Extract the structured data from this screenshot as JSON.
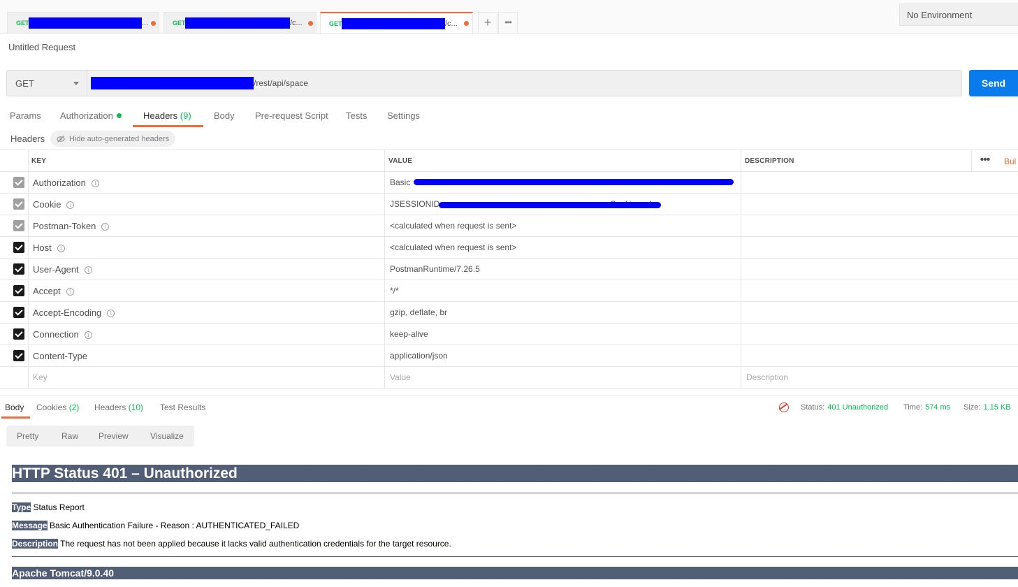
{
  "tabs": [
    {
      "method": "GET",
      "name": "...",
      "redact_width": 162
    },
    {
      "method": "GET",
      "name": "/c...",
      "redact_width": 150
    },
    {
      "method": "GET",
      "name": "/c...",
      "redact_width": 148,
      "active": true
    }
  ],
  "tab_actions": {
    "add": "+",
    "more": "•••"
  },
  "environment": "No Environment",
  "request_title": "Untitled Request",
  "url_bar": {
    "method": "GET",
    "url_suffix": "/rest/api/space",
    "send_label": "Send"
  },
  "request_tabs": [
    {
      "label": "Params"
    },
    {
      "label": "Authorization",
      "dot": true
    },
    {
      "label": "Headers",
      "count": "(9)",
      "active": true
    },
    {
      "label": "Body"
    },
    {
      "label": "Pre-request Script"
    },
    {
      "label": "Tests"
    },
    {
      "label": "Settings"
    }
  ],
  "headers_section": {
    "label": "Headers",
    "hide_auto": "Hide auto-generated headers"
  },
  "table": {
    "columns": [
      "KEY",
      "VALUE",
      "DESCRIPTION"
    ],
    "more": "•••",
    "bulk": "Bul",
    "rows": [
      {
        "key": "Authorization",
        "value": "Basic",
        "checked": true,
        "auto": true
      },
      {
        "key": "Cookie",
        "value": "JSESSIONID=",
        "value_tail": "; Cookie=value",
        "checked": true,
        "auto": true
      },
      {
        "key": "Postman-Token",
        "value": "<calculated when request is sent>",
        "checked": true,
        "auto": true
      },
      {
        "key": "Host",
        "value": "<calculated when request is sent>",
        "checked": true
      },
      {
        "key": "User-Agent",
        "value": "PostmanRuntime/7.26.5",
        "checked": true
      },
      {
        "key": "Accept",
        "value": "*/*",
        "checked": true
      },
      {
        "key": "Accept-Encoding",
        "value": "gzip, deflate, br",
        "checked": true
      },
      {
        "key": "Connection",
        "value": "keep-alive",
        "checked": true
      },
      {
        "key": "Content-Type",
        "value": "application/json",
        "checked": true,
        "no_info": true
      }
    ],
    "placeholders": {
      "key": "Key",
      "value": "Value",
      "description": "Description"
    }
  },
  "response": {
    "tabs": [
      {
        "label": "Body",
        "active": true
      },
      {
        "label": "Cookies",
        "count": "(2)"
      },
      {
        "label": "Headers",
        "count": "(10)"
      },
      {
        "label": "Test Results"
      }
    ],
    "status_label": "Status:",
    "status_value": "401 Unauthorized",
    "time_label": "Time:",
    "time_value": "574 ms",
    "size_label": "Size:",
    "size_value": "1.15 KB",
    "view_modes": [
      "Pretty",
      "Raw",
      "Preview",
      "Visualize"
    ]
  },
  "error_page": {
    "title": "HTTP Status 401 – Unauthorized",
    "type_label": "Type",
    "type_value": "Status Report",
    "message_label": "Message",
    "message_value": "Basic Authentication Failure - Reason : AUTHENTICATED_FAILED",
    "description_label": "Description",
    "description_value": "The request has not been applied because it lacks valid authentication credentials for the target resource.",
    "footer": "Apache Tomcat/9.0.40"
  },
  "colors": {
    "accent": "#f26b3a",
    "send": "#097bed",
    "success": "#0cbb52",
    "redaction": "#0000ff",
    "tomcat_bar": "#525d76"
  }
}
